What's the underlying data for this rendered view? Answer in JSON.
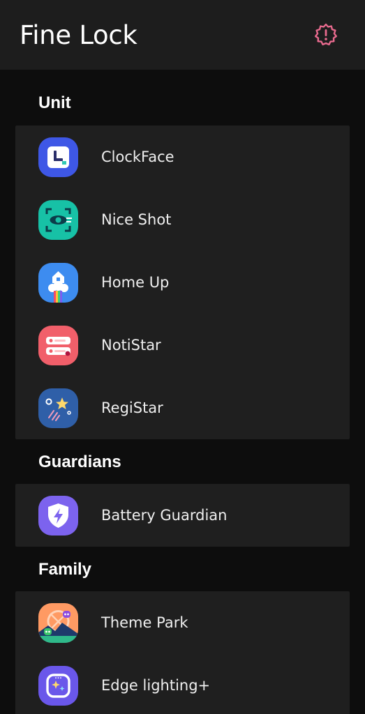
{
  "appbar": {
    "title": "Fine Lock",
    "alert_icon": "alert-badge-icon",
    "alert_color": "#e86a8e"
  },
  "sections": [
    {
      "title": "Unit",
      "items": [
        {
          "label": "ClockFace",
          "icon": "clockface-icon"
        },
        {
          "label": "Nice Shot",
          "icon": "niceshot-icon"
        },
        {
          "label": "Home Up",
          "icon": "homeup-icon"
        },
        {
          "label": "NotiStar",
          "icon": "notistar-icon"
        },
        {
          "label": "RegiStar",
          "icon": "registar-icon"
        }
      ]
    },
    {
      "title": "Guardians",
      "items": [
        {
          "label": "Battery Guardian",
          "icon": "battery-guardian-icon"
        }
      ]
    },
    {
      "title": "Family",
      "items": [
        {
          "label": "Theme Park",
          "icon": "theme-park-icon"
        },
        {
          "label": "Edge lighting+",
          "icon": "edge-lighting-icon"
        }
      ]
    }
  ]
}
